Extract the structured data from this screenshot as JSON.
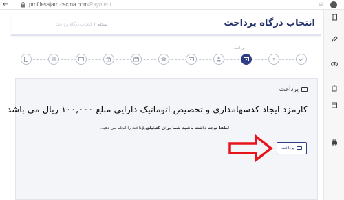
{
  "browser": {
    "url_host": "profilesajam.cscma.com",
    "url_path": "/Payment"
  },
  "header": {
    "title": "انتخاب درگاه پرداخت",
    "breadcrumb": [
      "سجام",
      "انتخاب درگاه پرداخت"
    ]
  },
  "steps": {
    "active_label": "پرداخت",
    "icons": [
      "document-icon",
      "rows-icon",
      "card-icon",
      "bank-icon",
      "briefcase-icon",
      "mortarboard-icon",
      "id-icon",
      "person-icon",
      "payment-icon",
      "question-icon",
      "check-icon"
    ],
    "active_index": 8
  },
  "panel": {
    "head": "پرداخت",
    "title": "کارمزد ایجاد کدسهامداری و تخصیص اتوماتیک دارایی مبلغ ۱۰۰,۰۰۰ ریال می باشد",
    "notice_bold": "لطفا توجه داشته باشید شما برای کد ملی :",
    "notice_rest": "عملیات پرداخت را انجام می دهید.",
    "pay_button": "پرداخت"
  },
  "colors": {
    "brand": "#2f3f86",
    "arrow": "#e8141b"
  }
}
